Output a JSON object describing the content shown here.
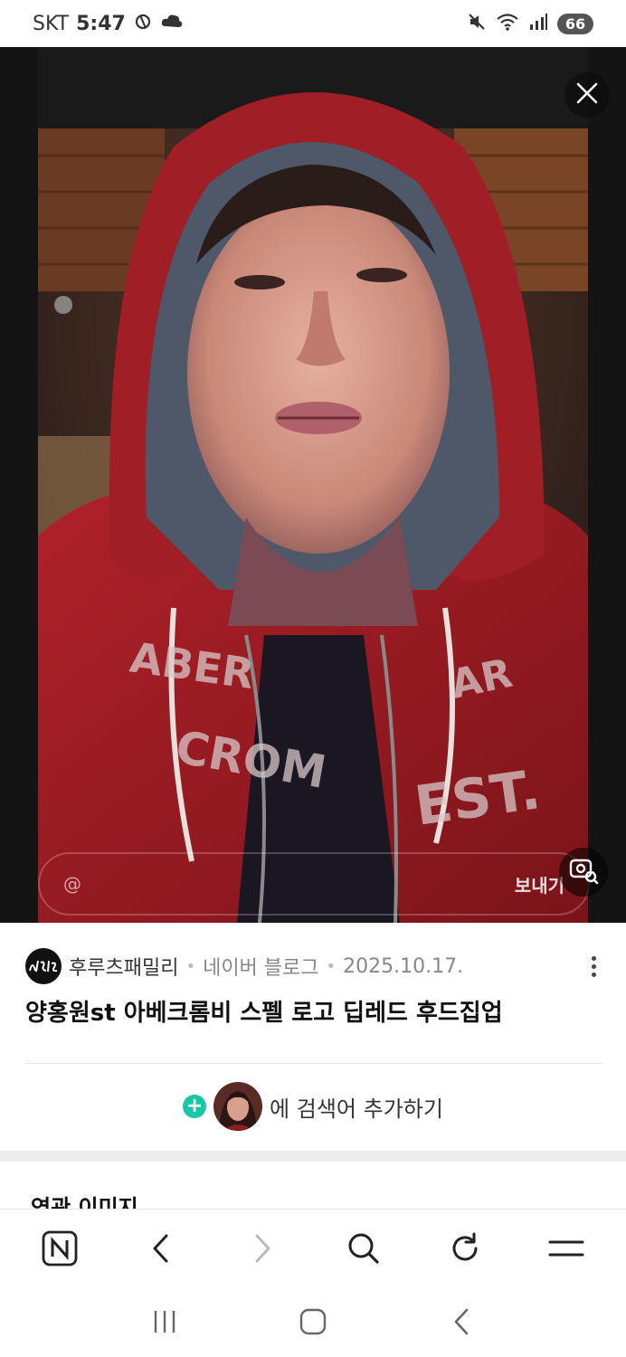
{
  "status_bar": {
    "carrier": "SKT",
    "time": "5:47",
    "battery": "66"
  },
  "viewer": {
    "comment_placeholder": "@",
    "send_label": "보내기"
  },
  "post": {
    "blog_name": "후루츠패밀리",
    "source": "네이버 블로그",
    "date": "2025.10.17.",
    "title": "양홍원st 아베크롬비 스펠 로고 딥레드 후드집업"
  },
  "add_search": {
    "label": "에 검색어 추가하기"
  },
  "section": {
    "title": "연관 이미지"
  },
  "icons": {
    "mute": "mute-icon",
    "wifi": "wifi-icon",
    "signal": "signal-icon",
    "close": "close-icon",
    "lens": "image-search-icon"
  },
  "colors": {
    "accent": "#19c6a5",
    "hoodie": "#9a1820"
  }
}
